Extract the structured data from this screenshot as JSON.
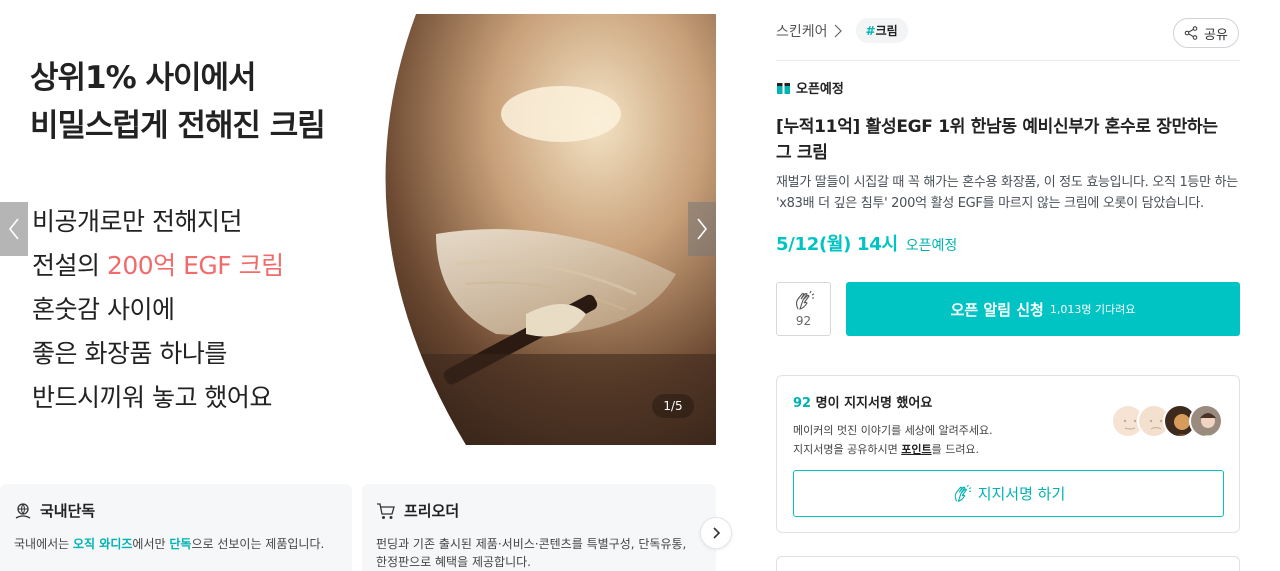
{
  "carousel": {
    "headline_lines": [
      "상위1% 사이에서",
      "비밀스럽게 전해진 크림"
    ],
    "body_lines": [
      {
        "text": "비공개로만 전해지던",
        "highlight": ""
      },
      {
        "text": "전설의 ",
        "highlight": "200억 EGF 크림"
      },
      {
        "text": "혼숫감 사이에",
        "highlight": ""
      },
      {
        "text": "좋은 화장품 하나를",
        "highlight": ""
      },
      {
        "text": "반드시끼워 놓고 했어요",
        "highlight": ""
      }
    ],
    "highlight_color": "#f26b6b",
    "counter": "1/5",
    "prev_icon": "chevron-left-icon",
    "next_icon": "chevron-right-icon"
  },
  "features": [
    {
      "icon": "globe-hand-icon",
      "title": "국내단독",
      "desc_parts": [
        {
          "text": "국내에서는 ",
          "accent": false
        },
        {
          "text": "오직 와디즈",
          "accent": true
        },
        {
          "text": "에서만 ",
          "accent": false
        },
        {
          "text": "단독",
          "accent": true
        },
        {
          "text": "으로 선보이는 제품입니다.",
          "accent": false
        }
      ]
    },
    {
      "icon": "cart-icon",
      "title": "프리오더",
      "desc_lines": [
        "펀딩과 기존 출시된 제품·서비스·콘텐츠를 특별구성, 단독유통,",
        "한정판으로 혜택을 제공합니다."
      ]
    }
  ],
  "info": {
    "breadcrumb": "스킨케어",
    "tag_hash": "#",
    "tag": "크림",
    "share_label": "공유",
    "status": "오픈예정",
    "title": "[누적11억] 활성EGF 1위 한남동 예비신부가 혼수로 장만하는 그 크림",
    "description": "재벌가 딸들이 시집갈 때 꼭 해가는 혼수용 화장품, 이 정도 효능입니다. 오직 1등만 하는 'x83배 더 깊은 침투' 200억 활성 EGF를 마르지 않는 크림에 오롯이 담았습니다.",
    "open_date": "5/12(월) 14시",
    "open_label": "오픈예정",
    "clap_count": "92",
    "notify_main": "오픈 알림 신청",
    "notify_sub": "1,013명 기다려요",
    "accent": "#00c4c4"
  },
  "support": {
    "count": "92",
    "head_rest": " 명이 지지서명 했어요",
    "line1": "메이커의 멋진 이야기를 세상에 알려주세요.",
    "line2_pre": "지지서명을 공유하시면 ",
    "line2_point": "포인트",
    "line2_post": "를 드려요.",
    "button": "지지서명 하기"
  }
}
